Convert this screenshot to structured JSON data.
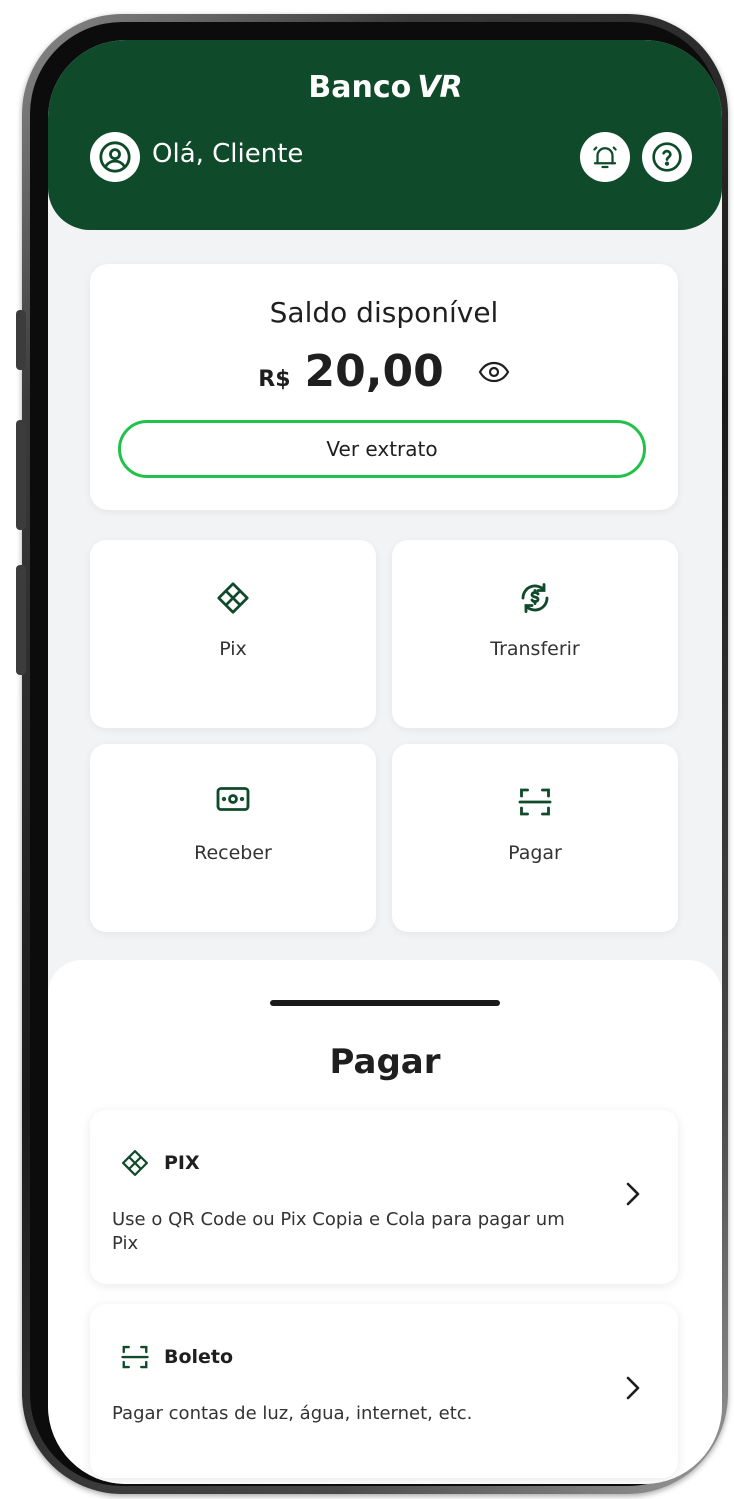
{
  "header": {
    "brand_name": "Banco",
    "brand_mark": "VR",
    "greeting": "Olá, Cliente",
    "icons": {
      "avatar": "user-circle-icon",
      "notifications": "bell-icon",
      "help": "help-circle-icon"
    }
  },
  "balance": {
    "title": "Saldo disponível",
    "currency": "R$",
    "amount": "20,00",
    "visibility_icon": "eye-icon",
    "statement_button": "Ver extrato"
  },
  "actions": [
    {
      "label": "Pix",
      "icon": "pix-icon"
    },
    {
      "label": "Transferir",
      "icon": "transfer-icon"
    },
    {
      "label": "Receber",
      "icon": "receive-money-icon"
    },
    {
      "label": "Pagar",
      "icon": "scan-icon"
    }
  ],
  "pay_sheet": {
    "title": "Pagar",
    "options": [
      {
        "title": "PIX",
        "description": "Use o QR Code ou Pix Copia e Cola para pagar um Pix",
        "icon": "pix-icon"
      },
      {
        "title": "Boleto",
        "description": "Pagar contas de luz, água, internet, etc.",
        "icon": "scan-icon"
      }
    ]
  },
  "colors": {
    "brand_green": "#0f4a2a",
    "accent_green": "#22c24a",
    "background": "#f1f3f5"
  }
}
